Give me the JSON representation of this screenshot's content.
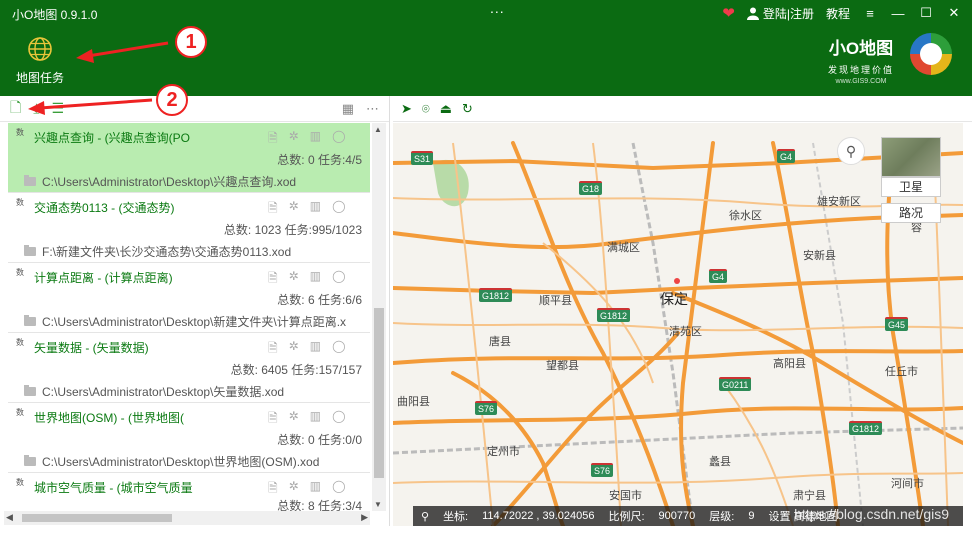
{
  "app": {
    "title": "小O地图 0.9.1.0",
    "dots": "..."
  },
  "header": {
    "login": "登陆|注册",
    "tutorial": "教程",
    "menu_icon": "menu-icon",
    "map_task_label": "地图任务",
    "brand_name": "小O地图",
    "brand_slogan": "发现地理价值",
    "brand_url": "www.GIS9.COM"
  },
  "annotations": [
    "1",
    "2"
  ],
  "tasks": [
    {
      "tag": "数",
      "name": "兴趣点查询 - (兴趣点查询(PO",
      "stats": "总数: 0 任务:4/5",
      "path": "C:\\Users\\Administrator\\Desktop\\兴趣点查询.xod",
      "selected": true
    },
    {
      "tag": "数",
      "name": "交通态势0113 - (交通态势)",
      "stats": "总数: 1023 任务:995/1023",
      "path": "F:\\新建文件夹\\长沙交通态势\\交通态势0113.xod",
      "selected": false
    },
    {
      "tag": "数",
      "name": "计算点距离 - (计算点距离)",
      "stats": "总数: 6 任务:6/6",
      "path": "C:\\Users\\Administrator\\Desktop\\新建文件夹\\计算点距离.x",
      "selected": false
    },
    {
      "tag": "数",
      "name": "矢量数据 - (矢量数据)",
      "stats": "总数: 6405 任务:157/157",
      "path": "C:\\Users\\Administrator\\Desktop\\矢量数据.xod",
      "selected": false
    },
    {
      "tag": "数",
      "name": "世界地图(OSM) - (世界地图(",
      "stats": "总数: 0 任务:0/0",
      "path": "C:\\Users\\Administrator\\Desktop\\世界地图(OSM).xod",
      "selected": false
    },
    {
      "tag": "数",
      "name": "城市空气质量 - (城市空气质量",
      "stats": "总数: 8 任务:3/4",
      "path": "",
      "selected": false
    }
  ],
  "map": {
    "layers": {
      "satellite": "卫星",
      "road": "路况"
    },
    "labels": [
      {
        "text": "徐水区"
      },
      {
        "text": "雄安新区"
      },
      {
        "text": "满城区"
      },
      {
        "text": "安新县"
      },
      {
        "text": "保定"
      },
      {
        "text": "顺平县"
      },
      {
        "text": "清苑区"
      },
      {
        "text": "唐县"
      },
      {
        "text": "望都县"
      },
      {
        "text": "高阳县"
      },
      {
        "text": "任丘市"
      },
      {
        "text": "曲阳县"
      },
      {
        "text": "定州市"
      },
      {
        "text": "蠡县"
      },
      {
        "text": "安国市"
      },
      {
        "text": "肃宁县"
      },
      {
        "text": "河间市"
      },
      {
        "text": "容"
      }
    ],
    "roads": [
      "S31",
      "G4",
      "G18",
      "G4",
      "G1812",
      "G1812",
      "G45",
      "G0211",
      "S76",
      "G1812",
      "S76"
    ],
    "status": {
      "coord_label": "坐标:",
      "coord_value": "114.72022 , 39.024056",
      "scale_label": "比例尺:",
      "scale_value": "900770",
      "level_label": "层级:",
      "level_value": "9",
      "source": "设置 高德地图",
      "watermark": "https://blog.csdn.net/gis9"
    }
  }
}
